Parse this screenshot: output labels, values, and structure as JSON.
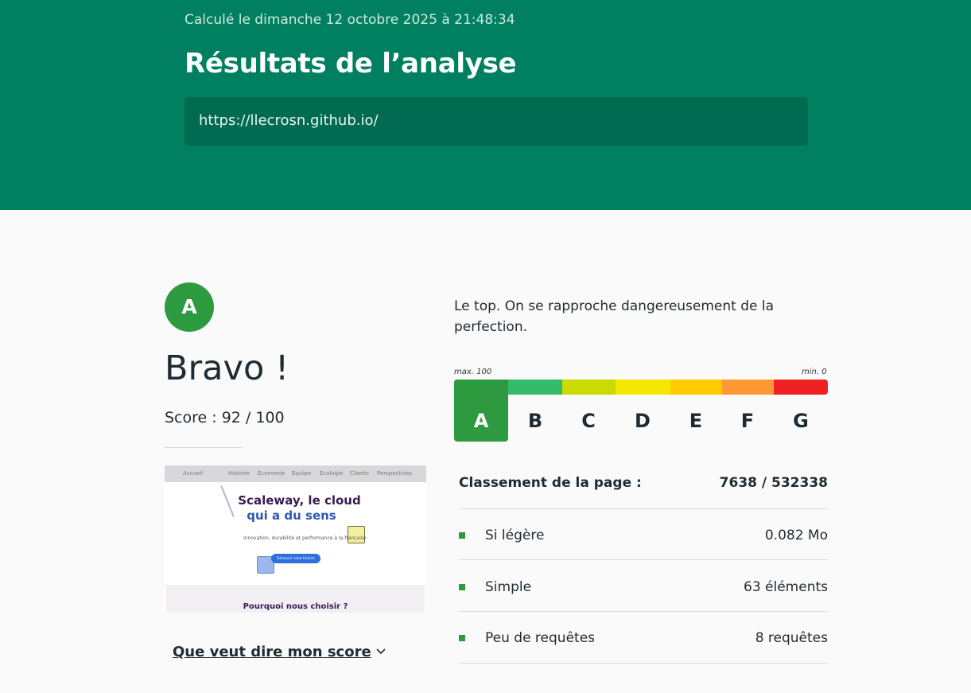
{
  "header": {
    "calculated_at": "Calculé le dimanche 12 octobre 2025 à 21:48:34",
    "title": "Résultats de l’analyse",
    "url": "https://llecrosn.github.io/",
    "background_color": "#008060"
  },
  "result": {
    "grade": "A",
    "headline": "Bravo !",
    "score_text": "Score : 92 / 100",
    "description": "Le top. On se rapproche dangereusement de la perfection.",
    "explain_link": "Que veut dire mon score",
    "grade_color": "#2e9a40"
  },
  "thumbnail": {
    "nav": [
      "Accueil",
      "Histoire",
      "Économie",
      "Équipe",
      "Écologie",
      "Clients",
      "Perspectives"
    ],
    "heading_line1": "Scaleway, le cloud",
    "heading_line2": "qui a du sens",
    "subtitle": "Innovation, durabilité et performance à la française",
    "button": "Découvrir notre histoire",
    "section_title": "Pourquoi nous choisir ?"
  },
  "scale": {
    "max_label": "max. 100",
    "min_label": "min. 0",
    "active": "A",
    "grades": [
      {
        "label": "A",
        "color": "#2e9a40"
      },
      {
        "label": "B",
        "color": "#34bb6b"
      },
      {
        "label": "C",
        "color": "#cbdb00"
      },
      {
        "label": "D",
        "color": "#f5e800"
      },
      {
        "label": "E",
        "color": "#ffcc00"
      },
      {
        "label": "F",
        "color": "#ff9933"
      },
      {
        "label": "G",
        "color": "#ee2222"
      }
    ]
  },
  "ranking": {
    "label": "Classement de la page :",
    "value": "7638 / 532338"
  },
  "metrics": [
    {
      "label": "Si légère",
      "value": "0.082 Mo"
    },
    {
      "label": "Simple",
      "value": "63 éléments"
    },
    {
      "label": "Peu de requêtes",
      "value": "8 requêtes"
    }
  ]
}
